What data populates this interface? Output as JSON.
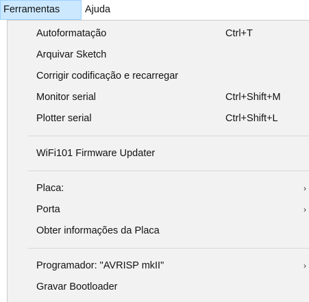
{
  "menubar": {
    "items": [
      {
        "label": "Ferramentas",
        "active": true
      },
      {
        "label": "Ajuda",
        "active": false
      }
    ]
  },
  "menu": {
    "groups": [
      [
        {
          "label": "Autoformatação",
          "shortcut": "Ctrl+T"
        },
        {
          "label": "Arquivar Sketch",
          "shortcut": ""
        },
        {
          "label": "Corrigir codificação e recarregar",
          "shortcut": ""
        },
        {
          "label": "Monitor serial",
          "shortcut": "Ctrl+Shift+M"
        },
        {
          "label": "Plotter serial",
          "shortcut": "Ctrl+Shift+L"
        }
      ],
      [
        {
          "label": "WiFi101 Firmware Updater",
          "shortcut": ""
        }
      ],
      [
        {
          "label": "Placa:",
          "submenu": true
        },
        {
          "label": "Porta",
          "submenu": true
        },
        {
          "label": "Obter informações da Placa",
          "shortcut": ""
        }
      ],
      [
        {
          "label": "Programador: \"AVRISP mkII\"",
          "submenu": true
        },
        {
          "label": "Gravar Bootloader",
          "shortcut": ""
        }
      ]
    ]
  },
  "colors": {
    "menubar_active_bg": "#cce8ff",
    "menubar_active_border": "#99d1ff",
    "dropdown_bg": "#f2f2f2",
    "separator": "#d7d7d7",
    "text": "#111111"
  },
  "icons": {
    "submenu": "chevron-right-icon"
  }
}
